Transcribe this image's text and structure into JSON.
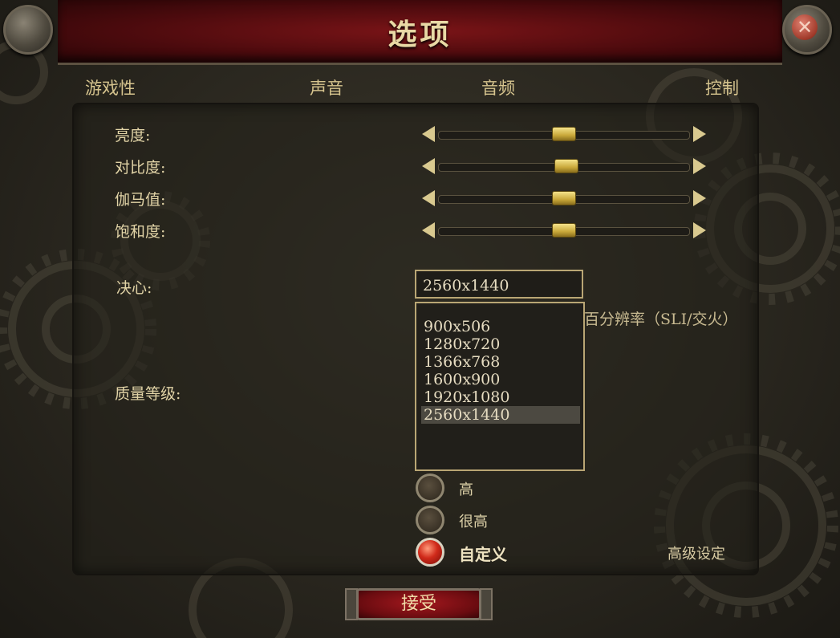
{
  "window": {
    "title": "选项",
    "close_icon": "close-icon"
  },
  "tabs": [
    {
      "label": "游戏性"
    },
    {
      "label": "声音"
    },
    {
      "label": "音频"
    },
    {
      "label": "控制"
    }
  ],
  "sliders": [
    {
      "label": "亮度:",
      "value": 0.5
    },
    {
      "label": "对比度:",
      "value": 0.51
    },
    {
      "label": "伽马值:",
      "value": 0.5
    },
    {
      "label": "饱和度:",
      "value": 0.5
    }
  ],
  "resolution": {
    "label": "决心:",
    "selected": "2560x1440",
    "options": [
      "900x506",
      "1280x720",
      "1366x768",
      "1600x900",
      "1920x1080",
      "2560x1440"
    ],
    "partial_behind_text": "百分辨率（SLI/交火）"
  },
  "quality": {
    "label": "质量等级:",
    "options": [
      {
        "label": "高",
        "selected": false
      },
      {
        "label": "很高",
        "selected": false
      },
      {
        "label": "自定义",
        "selected": true
      }
    ]
  },
  "advanced": {
    "label": "高级设定"
  },
  "footer": {
    "accept_label": "接受"
  },
  "colors": {
    "accent_gold": "#d6c48e",
    "title_red": "#7a1417",
    "selected_radio": "#d02a1a"
  }
}
